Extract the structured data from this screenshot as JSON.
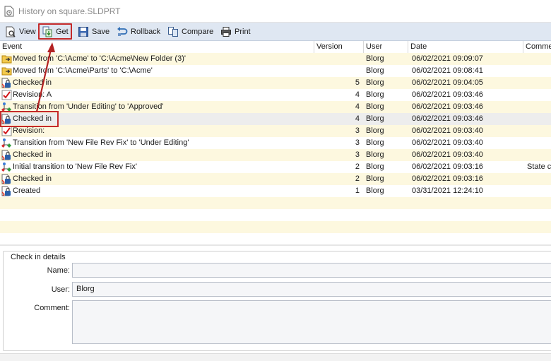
{
  "window": {
    "title": "History on square.SLDPRT"
  },
  "toolbar": {
    "view": "View",
    "get": "Get",
    "save": "Save",
    "rollback": "Rollback",
    "compare": "Compare",
    "print": "Print"
  },
  "columns": {
    "event": "Event",
    "version": "Version",
    "user": "User",
    "date": "Date",
    "comment": "Comme"
  },
  "rows": [
    {
      "icon": "folder-move-icon",
      "event": "Moved from 'C:\\Acme' to 'C:\\Acme\\New Folder (3)'",
      "version": "",
      "user": "Blorg",
      "date": "06/02/2021 09:09:07",
      "comment": ""
    },
    {
      "icon": "folder-move-icon",
      "event": "Moved from 'C:\\Acme\\Parts' to 'C:\\Acme'",
      "version": "",
      "user": "Blorg",
      "date": "06/02/2021 09:08:41",
      "comment": ""
    },
    {
      "icon": "checkin-icon",
      "event": "Checked in",
      "version": "5",
      "user": "Blorg",
      "date": "06/02/2021 09:04:05",
      "comment": ""
    },
    {
      "icon": "revision-check-icon",
      "event": "Revision: A",
      "version": "4",
      "user": "Blorg",
      "date": "06/02/2021 09:03:46",
      "comment": ""
    },
    {
      "icon": "transition-icon",
      "event": "Transition from 'Under Editing' to 'Approved'",
      "version": "4",
      "user": "Blorg",
      "date": "06/02/2021 09:03:46",
      "comment": ""
    },
    {
      "icon": "checkin-icon",
      "event": "Checked in",
      "version": "4",
      "user": "Blorg",
      "date": "06/02/2021 09:03:46",
      "comment": ""
    },
    {
      "icon": "revision-check-icon",
      "event": "Revision:",
      "version": "3",
      "user": "Blorg",
      "date": "06/02/2021 09:03:40",
      "comment": ""
    },
    {
      "icon": "transition-icon",
      "event": "Transition from 'New File Rev Fix' to 'Under Editing'",
      "version": "3",
      "user": "Blorg",
      "date": "06/02/2021 09:03:40",
      "comment": ""
    },
    {
      "icon": "checkin-icon",
      "event": "Checked in",
      "version": "3",
      "user": "Blorg",
      "date": "06/02/2021 09:03:40",
      "comment": ""
    },
    {
      "icon": "transition-icon",
      "event": "Initial transition to 'New File Rev Fix'",
      "version": "2",
      "user": "Blorg",
      "date": "06/02/2021 09:03:16",
      "comment": "State ch"
    },
    {
      "icon": "checkin-icon",
      "event": "Checked in",
      "version": "2",
      "user": "Blorg",
      "date": "06/02/2021 09:03:16",
      "comment": ""
    },
    {
      "icon": "checkin-icon",
      "event": "Created",
      "version": "1",
      "user": "Blorg",
      "date": "03/31/2021 12:24:10",
      "comment": ""
    }
  ],
  "selected_row_index": 5,
  "details": {
    "legend": "Check in details",
    "name_label": "Name:",
    "name_value": "",
    "user_label": "User:",
    "user_value": "Blorg",
    "comment_label": "Comment:",
    "comment_value": ""
  },
  "colors": {
    "row_alt": "#fdf8df",
    "row_selected": "#ededed",
    "toolbar_bg": "#dfe7f2",
    "highlight": "#c42a2a"
  }
}
